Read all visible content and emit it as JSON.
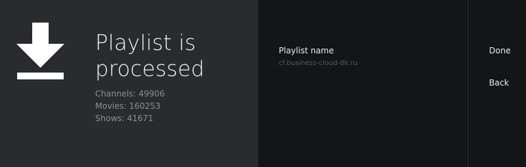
{
  "status": {
    "icon": "download-icon",
    "title_line1": "Playlist is",
    "title_line2": "processed",
    "channels": "Channels: 49906",
    "movies": "Movies: 160253",
    "shows": "Shows: 41671"
  },
  "playlist": {
    "name_label": "Playlist name",
    "name_value": "cf.business-cloud-8k.ru"
  },
  "actions": {
    "done_label": "Done",
    "back_label": "Back"
  },
  "colors": {
    "left_background": "#2a2b2e",
    "right_background": "#141517",
    "primary_text": "#f2f2f2",
    "secondary_text": "#8e8f92"
  }
}
